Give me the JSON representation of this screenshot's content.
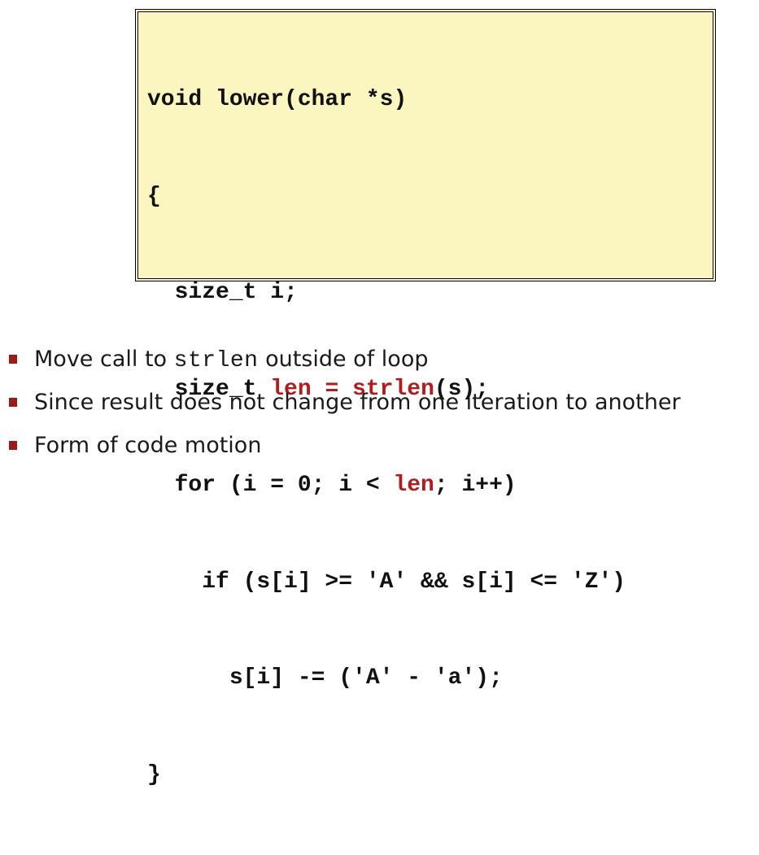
{
  "code": {
    "lines": [
      [
        {
          "t": "void lower(char *s)",
          "hl": false
        }
      ],
      [
        {
          "t": "{",
          "hl": false
        }
      ],
      [
        {
          "t": "  size_t i;",
          "hl": false
        }
      ],
      [
        {
          "t": "  size_t ",
          "hl": false
        },
        {
          "t": "len = strlen",
          "hl": true
        },
        {
          "t": "(s);",
          "hl": false
        }
      ],
      [
        {
          "t": "  for (i = 0; i < ",
          "hl": false
        },
        {
          "t": "len",
          "hl": true
        },
        {
          "t": "; i++)",
          "hl": false
        }
      ],
      [
        {
          "t": "    if (s[i] >= 'A' && s[i] <= 'Z')",
          "hl": false
        }
      ],
      [
        {
          "t": "      s[i] -= ('A' - 'a');",
          "hl": false
        }
      ],
      [
        {
          "t": "}",
          "hl": false
        }
      ]
    ],
    "highlight_color": "#b01d1d",
    "background_color": "#fbf6c0"
  },
  "bullets": [
    {
      "before": "Move call to ",
      "code": "strlen",
      "after": " outside of loop"
    },
    {
      "before": "Since result does not change from one iteration to another",
      "code": "",
      "after": ""
    },
    {
      "before": "Form of code motion",
      "code": "",
      "after": ""
    }
  ],
  "bullet_color": "#9b1b1b"
}
